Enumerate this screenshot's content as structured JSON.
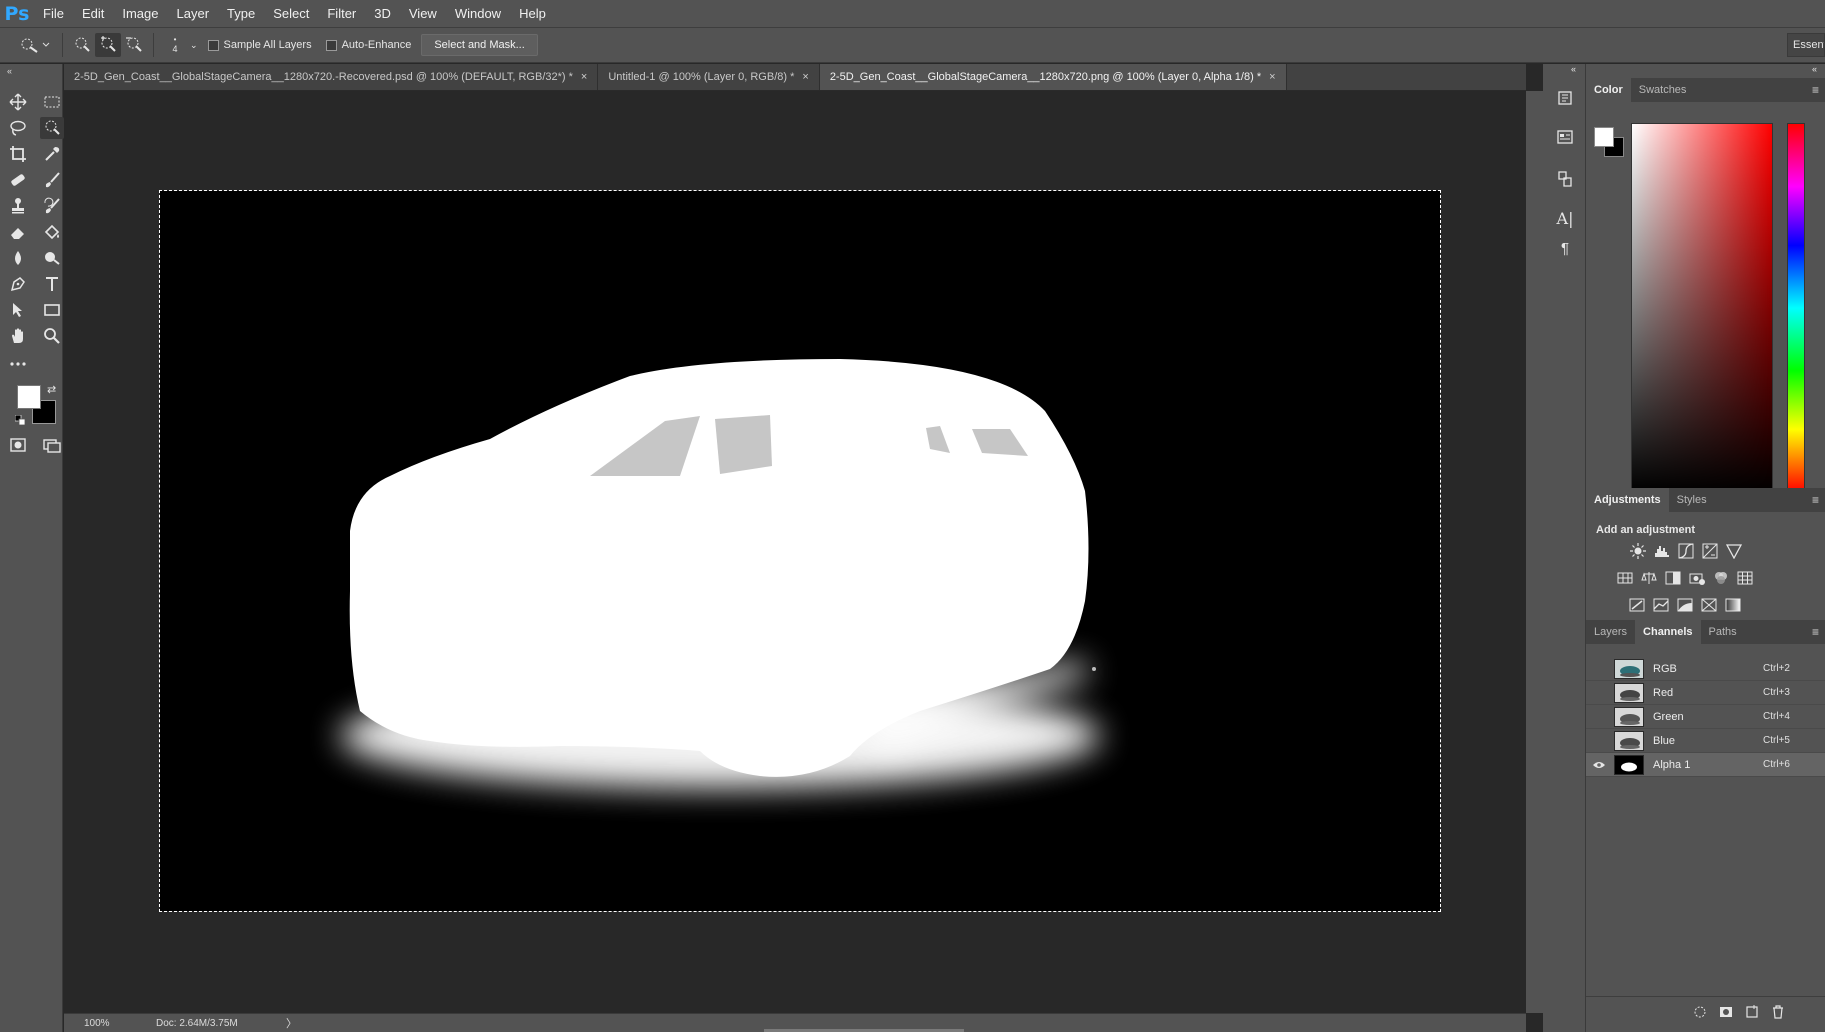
{
  "app": {
    "logo": "Ps",
    "menu": [
      "File",
      "Edit",
      "Image",
      "Layer",
      "Type",
      "Select",
      "Filter",
      "3D",
      "View",
      "Window",
      "Help"
    ]
  },
  "options": {
    "brush_size": "4",
    "sample_all_layers": "Sample All Layers",
    "auto_enhance": "Auto-Enhance",
    "select_and_mask": "Select and Mask...",
    "workspace": "Essentials"
  },
  "tabs": [
    {
      "label": "2-5D_Gen_Coast__GlobalStageCamera__1280x720.-Recovered.psd @ 100% (DEFAULT, RGB/32*) *",
      "close": "×"
    },
    {
      "label": "Untitled-1 @ 100% (Layer 0, RGB/8) *",
      "close": "×"
    },
    {
      "label": "2-5D_Gen_Coast__GlobalStageCamera__1280x720.png @ 100% (Layer 0, Alpha 1/8) *",
      "close": "×"
    }
  ],
  "status": {
    "zoom": "100%",
    "doc": "Doc: 2.64M/3.75M",
    "arrow": "〉"
  },
  "color_panel": {
    "tabs": [
      "Color",
      "Swatches"
    ],
    "foreground": "#ffffff",
    "background": "#000000",
    "hue": "#ff0000"
  },
  "adjustments_panel": {
    "tabs": [
      "Adjustments",
      "Styles"
    ],
    "heading": "Add an adjustment"
  },
  "channels_panel": {
    "tabs": [
      "Layers",
      "Channels",
      "Paths"
    ],
    "channels": [
      {
        "name": "RGB",
        "shortcut": "Ctrl+2",
        "visible": false
      },
      {
        "name": "Red",
        "shortcut": "Ctrl+3",
        "visible": false
      },
      {
        "name": "Green",
        "shortcut": "Ctrl+4",
        "visible": false
      },
      {
        "name": "Blue",
        "shortcut": "Ctrl+5",
        "visible": false
      },
      {
        "name": "Alpha 1",
        "shortcut": "Ctrl+6",
        "visible": true
      }
    ]
  }
}
